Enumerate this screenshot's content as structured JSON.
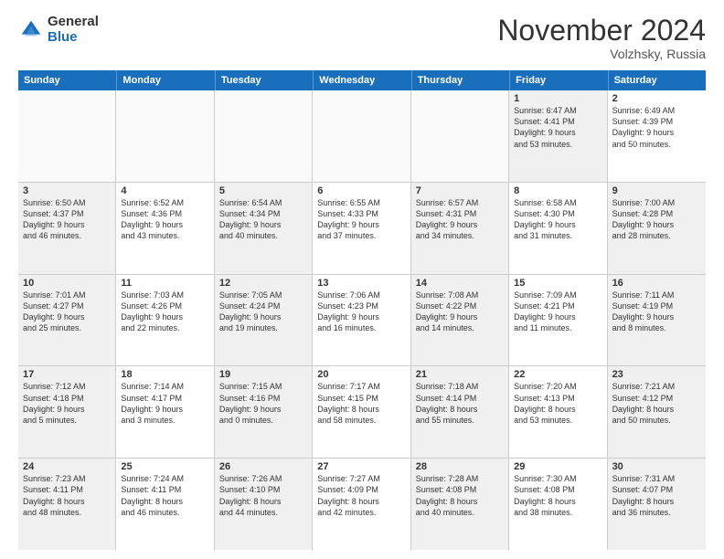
{
  "logo": {
    "general": "General",
    "blue": "Blue"
  },
  "title": "November 2024",
  "location": "Volzhsky, Russia",
  "days_header": [
    "Sunday",
    "Monday",
    "Tuesday",
    "Wednesday",
    "Thursday",
    "Friday",
    "Saturday"
  ],
  "weeks": [
    [
      {
        "day": "",
        "info": "",
        "empty": true
      },
      {
        "day": "",
        "info": "",
        "empty": true
      },
      {
        "day": "",
        "info": "",
        "empty": true
      },
      {
        "day": "",
        "info": "",
        "empty": true
      },
      {
        "day": "",
        "info": "",
        "empty": true
      },
      {
        "day": "1",
        "info": "Sunrise: 6:47 AM\nSunset: 4:41 PM\nDaylight: 9 hours\nand 53 minutes.",
        "shaded": true
      },
      {
        "day": "2",
        "info": "Sunrise: 6:49 AM\nSunset: 4:39 PM\nDaylight: 9 hours\nand 50 minutes.",
        "shaded": false
      }
    ],
    [
      {
        "day": "3",
        "info": "Sunrise: 6:50 AM\nSunset: 4:37 PM\nDaylight: 9 hours\nand 46 minutes.",
        "shaded": true
      },
      {
        "day": "4",
        "info": "Sunrise: 6:52 AM\nSunset: 4:36 PM\nDaylight: 9 hours\nand 43 minutes.",
        "shaded": false
      },
      {
        "day": "5",
        "info": "Sunrise: 6:54 AM\nSunset: 4:34 PM\nDaylight: 9 hours\nand 40 minutes.",
        "shaded": true
      },
      {
        "day": "6",
        "info": "Sunrise: 6:55 AM\nSunset: 4:33 PM\nDaylight: 9 hours\nand 37 minutes.",
        "shaded": false
      },
      {
        "day": "7",
        "info": "Sunrise: 6:57 AM\nSunset: 4:31 PM\nDaylight: 9 hours\nand 34 minutes.",
        "shaded": true
      },
      {
        "day": "8",
        "info": "Sunrise: 6:58 AM\nSunset: 4:30 PM\nDaylight: 9 hours\nand 31 minutes.",
        "shaded": false
      },
      {
        "day": "9",
        "info": "Sunrise: 7:00 AM\nSunset: 4:28 PM\nDaylight: 9 hours\nand 28 minutes.",
        "shaded": true
      }
    ],
    [
      {
        "day": "10",
        "info": "Sunrise: 7:01 AM\nSunset: 4:27 PM\nDaylight: 9 hours\nand 25 minutes.",
        "shaded": true
      },
      {
        "day": "11",
        "info": "Sunrise: 7:03 AM\nSunset: 4:26 PM\nDaylight: 9 hours\nand 22 minutes.",
        "shaded": false
      },
      {
        "day": "12",
        "info": "Sunrise: 7:05 AM\nSunset: 4:24 PM\nDaylight: 9 hours\nand 19 minutes.",
        "shaded": true
      },
      {
        "day": "13",
        "info": "Sunrise: 7:06 AM\nSunset: 4:23 PM\nDaylight: 9 hours\nand 16 minutes.",
        "shaded": false
      },
      {
        "day": "14",
        "info": "Sunrise: 7:08 AM\nSunset: 4:22 PM\nDaylight: 9 hours\nand 14 minutes.",
        "shaded": true
      },
      {
        "day": "15",
        "info": "Sunrise: 7:09 AM\nSunset: 4:21 PM\nDaylight: 9 hours\nand 11 minutes.",
        "shaded": false
      },
      {
        "day": "16",
        "info": "Sunrise: 7:11 AM\nSunset: 4:19 PM\nDaylight: 9 hours\nand 8 minutes.",
        "shaded": true
      }
    ],
    [
      {
        "day": "17",
        "info": "Sunrise: 7:12 AM\nSunset: 4:18 PM\nDaylight: 9 hours\nand 5 minutes.",
        "shaded": true
      },
      {
        "day": "18",
        "info": "Sunrise: 7:14 AM\nSunset: 4:17 PM\nDaylight: 9 hours\nand 3 minutes.",
        "shaded": false
      },
      {
        "day": "19",
        "info": "Sunrise: 7:15 AM\nSunset: 4:16 PM\nDaylight: 9 hours\nand 0 minutes.",
        "shaded": true
      },
      {
        "day": "20",
        "info": "Sunrise: 7:17 AM\nSunset: 4:15 PM\nDaylight: 8 hours\nand 58 minutes.",
        "shaded": false
      },
      {
        "day": "21",
        "info": "Sunrise: 7:18 AM\nSunset: 4:14 PM\nDaylight: 8 hours\nand 55 minutes.",
        "shaded": true
      },
      {
        "day": "22",
        "info": "Sunrise: 7:20 AM\nSunset: 4:13 PM\nDaylight: 8 hours\nand 53 minutes.",
        "shaded": false
      },
      {
        "day": "23",
        "info": "Sunrise: 7:21 AM\nSunset: 4:12 PM\nDaylight: 8 hours\nand 50 minutes.",
        "shaded": true
      }
    ],
    [
      {
        "day": "24",
        "info": "Sunrise: 7:23 AM\nSunset: 4:11 PM\nDaylight: 8 hours\nand 48 minutes.",
        "shaded": true
      },
      {
        "day": "25",
        "info": "Sunrise: 7:24 AM\nSunset: 4:11 PM\nDaylight: 8 hours\nand 46 minutes.",
        "shaded": false
      },
      {
        "day": "26",
        "info": "Sunrise: 7:26 AM\nSunset: 4:10 PM\nDaylight: 8 hours\nand 44 minutes.",
        "shaded": true
      },
      {
        "day": "27",
        "info": "Sunrise: 7:27 AM\nSunset: 4:09 PM\nDaylight: 8 hours\nand 42 minutes.",
        "shaded": false
      },
      {
        "day": "28",
        "info": "Sunrise: 7:28 AM\nSunset: 4:08 PM\nDaylight: 8 hours\nand 40 minutes.",
        "shaded": true
      },
      {
        "day": "29",
        "info": "Sunrise: 7:30 AM\nSunset: 4:08 PM\nDaylight: 8 hours\nand 38 minutes.",
        "shaded": false
      },
      {
        "day": "30",
        "info": "Sunrise: 7:31 AM\nSunset: 4:07 PM\nDaylight: 8 hours\nand 36 minutes.",
        "shaded": true
      }
    ]
  ]
}
